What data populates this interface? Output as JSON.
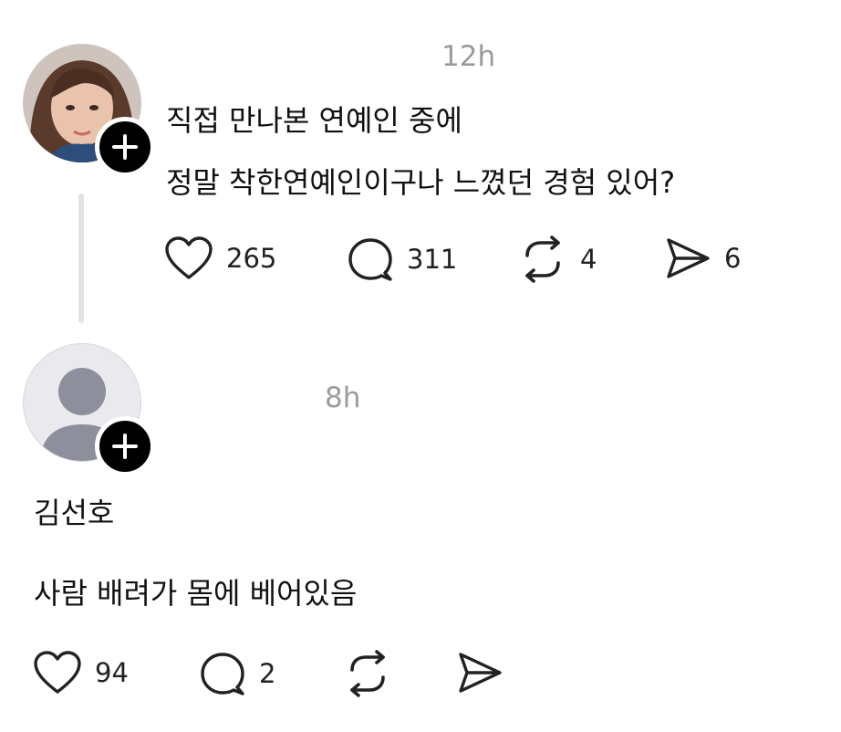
{
  "post": {
    "time": "12h",
    "line1": "직접 만나본 연예인 중에",
    "line2": "정말 착한연예인이구나 느꼈던 경험 있어?",
    "likes": "265",
    "replies": "311",
    "reposts": "4",
    "shares": "6",
    "avatar_icon": "profile-photo",
    "follow_icon": "plus-icon"
  },
  "reply": {
    "time": "8h",
    "author": "김선호",
    "text": "사람 배려가 몸에 베어있음",
    "likes": "94",
    "replies": "2",
    "avatar_icon": "default-avatar-icon",
    "follow_icon": "plus-icon"
  },
  "icons": [
    "heart-icon",
    "comment-icon",
    "repost-icon",
    "send-icon"
  ]
}
